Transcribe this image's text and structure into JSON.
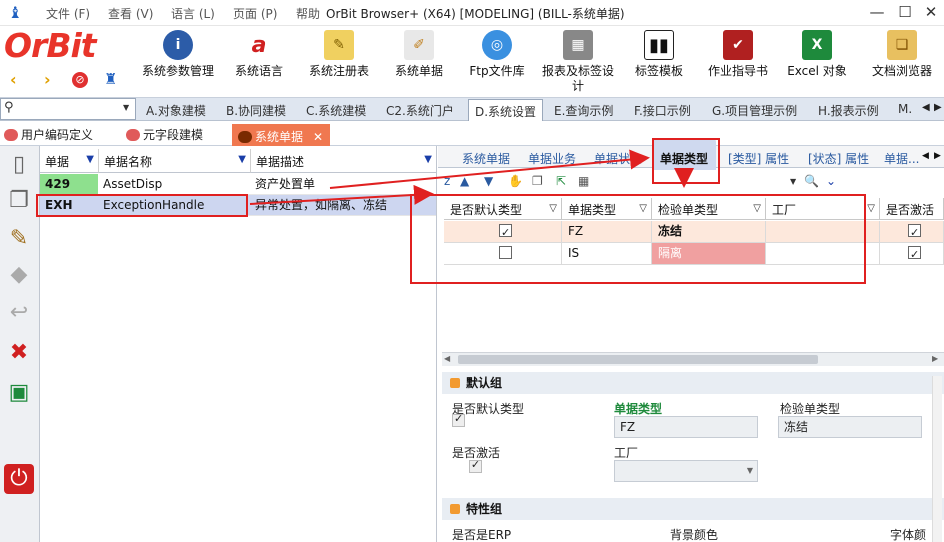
{
  "titlebar": {
    "menus": [
      "文件 (F)",
      "查看 (V)",
      "语言 (L)",
      "页面 (P)",
      "帮助"
    ],
    "title": "OrBit Browser+ (X64) [MODELING] (BILL-系统单据)",
    "minimize": "—",
    "maximize": "☐",
    "close": "✕"
  },
  "logo": {
    "text": "OrBit",
    "color": "#e8342a"
  },
  "toolbar": {
    "buttons": [
      "系统参数管理",
      "系统语言",
      "系统注册表",
      "系统单据",
      "Ftp文件库",
      "报表及标签设计",
      "标签模板",
      "作业指导书",
      "Excel 对象",
      "文档浏览器"
    ]
  },
  "nav": {
    "search_placeholder": "",
    "tabs": [
      "A.对象建模",
      "B.协同建模",
      "C.系统建模",
      "C2.系统门户",
      "D.系统设置",
      "E.查询示例",
      "F.接口示例",
      "G.项目管理示例",
      "H.报表示例",
      "M."
    ],
    "active_tab": "D.系统设置"
  },
  "doc_tabs": {
    "items": [
      "用户编码定义",
      "元字段建模",
      "系统单据"
    ],
    "close": "✕"
  },
  "left_grid": {
    "headers": [
      "单据",
      "单据名称",
      "单据描述"
    ],
    "rows": [
      {
        "code": "429",
        "name": "AssetDisp",
        "desc": "资产处置单"
      },
      {
        "code": "EXH",
        "name": "ExceptionHandle",
        "desc": "异常处置，如隔离、冻结"
      }
    ]
  },
  "right_tabs": {
    "items": [
      "系统单据",
      "单据业务",
      "单据状态",
      "单据类型",
      "[类型] 属性",
      "[状态] 属性",
      "单据..."
    ],
    "active": "单据类型"
  },
  "right_grid": {
    "headers": [
      "是否默认类型",
      "单据类型",
      "检验单类型",
      "工厂",
      "是否激活"
    ],
    "rows": [
      {
        "is_default": true,
        "type": "FZ",
        "check_type": "冻结",
        "factory": "",
        "active": true
      },
      {
        "is_default": false,
        "type": "IS",
        "check_type": "隔离",
        "factory": "",
        "active": true
      }
    ]
  },
  "default_group": {
    "title": "默认组",
    "is_default_label": "是否默认类型",
    "doc_type_label": "单据类型",
    "doc_type_value": "FZ",
    "check_type_label": "检验单类型",
    "check_type_value": "冻结",
    "active_label": "是否激活",
    "factory_label": "工厂"
  },
  "property_group": {
    "title": "特性组",
    "erp_label": "是否是ERP",
    "bg_color_label": "背景颜色",
    "font_color_label": "字体颜"
  },
  "colors": {
    "accent": "#f07850",
    "highlight_red": "#e02020",
    "code_green": "#8ee08e",
    "selected_row": "#cdd6f0"
  }
}
